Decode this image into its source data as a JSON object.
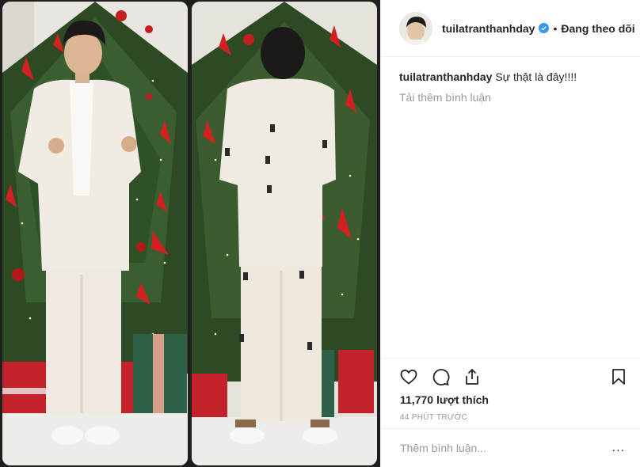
{
  "post": {
    "image_alt": "two photos of a person in a white suit in front of a decorated Christmas tree"
  },
  "header": {
    "username": "tuilatranthanhday",
    "separator": "•",
    "follow_state": "Đang theo dõi",
    "verified_icon": "verified-badge-icon",
    "avatar_icon": "profile-avatar"
  },
  "caption": {
    "username": "tuilatranthanhday",
    "text": "Sự thật là đây!!!!"
  },
  "comments": {
    "load_more": "Tải thêm bình luận"
  },
  "actions": {
    "like_icon": "heart-icon",
    "comment_icon": "comment-icon",
    "share_icon": "share-icon",
    "save_icon": "bookmark-icon"
  },
  "likes": {
    "count": "11,770",
    "label": "lượt thích"
  },
  "timestamp": "44 PHÚT TRƯỚC",
  "comment_box": {
    "placeholder": "Thêm bình luận...",
    "more": "..."
  },
  "colors": {
    "accent": "#3897f0",
    "muted": "#999999",
    "border": "#efefef",
    "text": "#262626"
  }
}
